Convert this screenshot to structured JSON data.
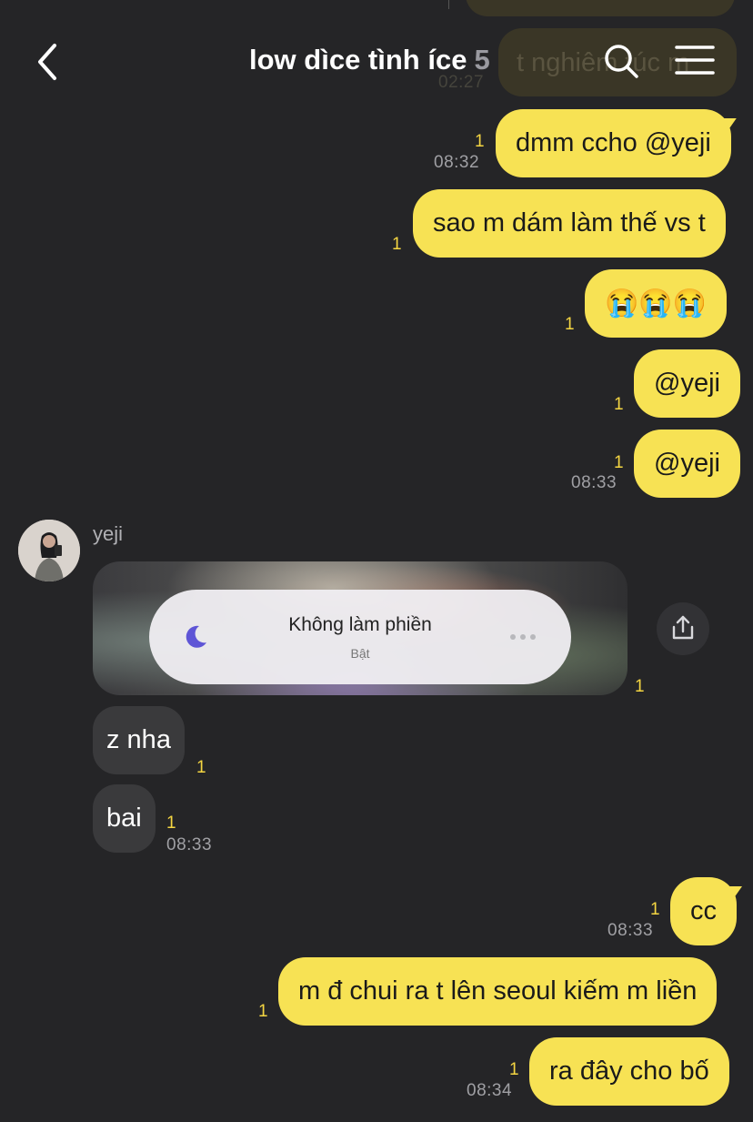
{
  "header": {
    "title": "low dìce tình íce",
    "member_count": "5"
  },
  "ghost": {
    "text": "t nghiêm túc m",
    "time": "02:27"
  },
  "messages_me_top": [
    {
      "text": "dmm ccho @yeji",
      "unread": "1",
      "time": "08:32"
    },
    {
      "text": "sao m dám làm thế vs t",
      "unread": "1",
      "time": ""
    },
    {
      "text": "😭😭😭",
      "unread": "1",
      "time": ""
    },
    {
      "text": "@yeji",
      "unread": "1",
      "time": ""
    },
    {
      "text": "@yeji",
      "unread": "1",
      "time": "08:33"
    }
  ],
  "other": {
    "name": "yeji",
    "media": {
      "title": "Không làm phiền",
      "subtitle": "Bật",
      "unread": "1"
    },
    "messages": [
      {
        "text": "z nha",
        "unread": "1",
        "time": ""
      },
      {
        "text": "bai",
        "unread": "1",
        "time": "08:33"
      }
    ]
  },
  "messages_me_bottom": [
    {
      "text": "cc",
      "unread": "1",
      "time": "08:33"
    },
    {
      "text": "m đ chui ra t lên seoul kiếm m liền",
      "unread": "1",
      "time": ""
    },
    {
      "text": "ra đây cho bố",
      "unread": "1",
      "time": "08:34"
    }
  ],
  "icons": {
    "back": "chevron-left-icon",
    "search": "search-icon",
    "menu": "hamburger-menu-icon",
    "share": "share-icon",
    "moon": "moon-icon",
    "more": "more-dots-icon"
  },
  "colors": {
    "background": "#252527",
    "my_bubble": "#f7e254",
    "other_bubble": "#3a3a3c",
    "unread": "#f5d642"
  }
}
